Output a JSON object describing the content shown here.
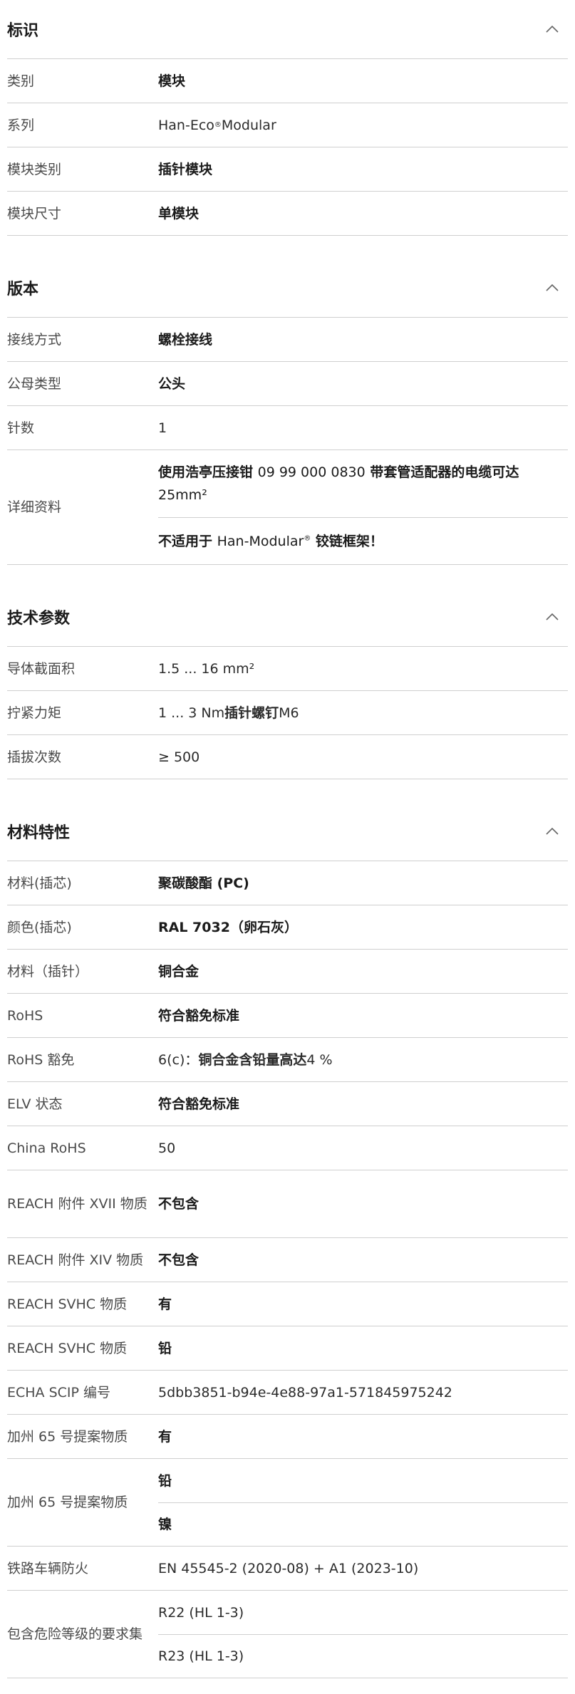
{
  "sections": [
    {
      "title": "标识",
      "rows": [
        {
          "label": "类别",
          "values": [
            "模块"
          ]
        },
        {
          "label": "系列",
          "value_prefix": "Han-Eco",
          "value_sup": "®",
          "value_suffix": " Modular"
        },
        {
          "label": "模块类别",
          "values": [
            "插针模块"
          ]
        },
        {
          "label": "模块尺寸",
          "values": [
            "单模块"
          ]
        }
      ]
    },
    {
      "title": "版本",
      "rows": [
        {
          "label": "接线方式",
          "values": [
            "螺栓接线"
          ]
        },
        {
          "label": "公母类型",
          "values": [
            "公头"
          ]
        },
        {
          "label": "针数",
          "values": [
            "1"
          ]
        },
        {
          "label": "详细资料",
          "detail_1": {
            "a": "使用浩亭压接钳 ",
            "b": "09 99 000 0830",
            "c": " 带套管适配器的电缆可达 ",
            "d": "25mm²"
          },
          "detail_2": {
            "a": "不适用于 ",
            "b": "Han-Modular",
            "sup": "®",
            "c": " 铰链框架！"
          }
        }
      ]
    },
    {
      "title": "技术参数",
      "rows": [
        {
          "label": "导体截面积",
          "values": [
            "1.5 ... 16 mm²"
          ]
        },
        {
          "label": "拧紧力矩",
          "torque": {
            "a": "1 ... 3 Nm ",
            "b": "插针螺钉",
            "c": "M6"
          }
        },
        {
          "label": "插拔次数",
          "values": [
            "≥ 500"
          ]
        }
      ]
    },
    {
      "title": "材料特性",
      "rows": [
        {
          "label": "材料(插芯)",
          "values": [
            "聚碳酸酯 (PC)"
          ]
        },
        {
          "label": "颜色(插芯)",
          "values": [
            "RAL 7032（卵石灰）"
          ]
        },
        {
          "label": "材料（插针）",
          "values": [
            "铜合金"
          ]
        },
        {
          "label": "RoHS",
          "values": [
            "符合豁免标准"
          ]
        },
        {
          "label": "RoHS 豁免",
          "rohs_exempt": {
            "a": "6(c)：",
            "b": "铜合金含铅量高达",
            "c": " 4 %"
          }
        },
        {
          "label": "ELV 状态",
          "values": [
            "符合豁免标准"
          ]
        },
        {
          "label": "China RoHS",
          "values": [
            "50"
          ]
        },
        {
          "label": "REACH 附件 XVII 物质",
          "values": [
            "不包含"
          ]
        },
        {
          "label": "REACH 附件 XIV 物质",
          "values": [
            "不包含"
          ]
        },
        {
          "label": "REACH SVHC 物质",
          "values": [
            "有"
          ]
        },
        {
          "label": "REACH SVHC 物质",
          "values": [
            "铅"
          ]
        },
        {
          "label": "ECHA SCIP 编号",
          "values": [
            "5dbb3851-b94e-4e88-97a1-571845975242"
          ]
        },
        {
          "label": "加州 65 号提案物质",
          "values": [
            "有"
          ]
        },
        {
          "label": "加州 65 号提案物质",
          "values": [
            "铅",
            "镍"
          ]
        },
        {
          "label": "铁路车辆防火",
          "values": [
            "EN 45545-2 (2020-08) + A1 (2023-10)"
          ]
        },
        {
          "label": "包含危险等级的要求集",
          "values": [
            "R22 (HL 1-3)",
            "R23 (HL 1-3)"
          ]
        }
      ]
    }
  ],
  "icons": {
    "section_toggle": "chevron-up-icon"
  },
  "colors": {
    "divider": "#cfcfcf",
    "text_strong": "#1b1b1b",
    "text_label": "#4a4a4a"
  }
}
